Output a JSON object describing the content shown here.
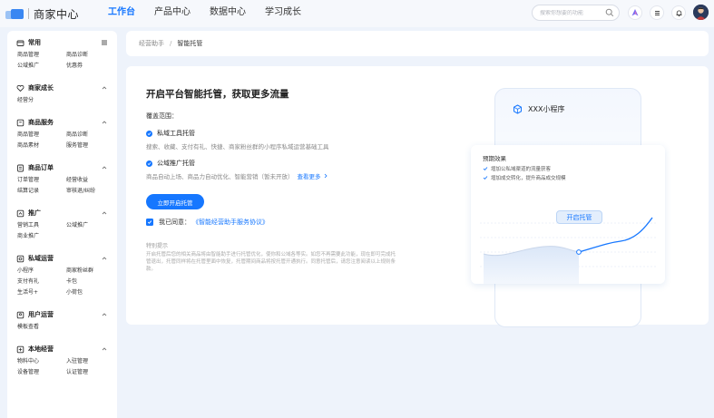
{
  "header": {
    "brand": "商家中心",
    "nav": [
      {
        "label": "工作台",
        "active": true
      },
      {
        "label": "产品中心",
        "active": false
      },
      {
        "label": "数据中心",
        "active": false
      },
      {
        "label": "学习成长",
        "active": false
      }
    ],
    "search_placeholder": "搜索你想要的功能",
    "icons": [
      "search-icon",
      "assistant-icon",
      "menu-icon",
      "bell-icon",
      "avatar"
    ],
    "accent": "#1677ff"
  },
  "sidebar": {
    "sections": [
      {
        "title": "常用",
        "icon": "folder-icon",
        "toggle": "list-icon",
        "items": [
          "商品管理",
          "商品诊断",
          "公域推广",
          "优惠券"
        ]
      },
      {
        "title": "商家成长",
        "icon": "heart-icon",
        "toggle": "chevron-up-icon",
        "items": [
          "经营分"
        ]
      },
      {
        "title": "商品服务",
        "icon": "box-icon",
        "toggle": "chevron-up-icon",
        "items": [
          "商品管理",
          "商品诊断",
          "商品素材",
          "服务管理"
        ]
      },
      {
        "title": "商品订单",
        "icon": "order-icon",
        "toggle": "chevron-up-icon",
        "items": [
          "订单管理",
          "经营收益",
          "结算记录",
          "审核退/纠纷"
        ]
      },
      {
        "title": "推广",
        "icon": "promo-icon",
        "toggle": "chevron-up-icon",
        "items": [
          "营销工具",
          "公域推广",
          "商业推广"
        ]
      },
      {
        "title": "私域运营",
        "icon": "private-icon",
        "toggle": "chevron-up-icon",
        "items": [
          "小程序",
          "商家粉丝群",
          "支付有礼",
          "卡包",
          "生活号+",
          "小荷包"
        ]
      },
      {
        "title": "用户运营",
        "icon": "user-icon",
        "toggle": "chevron-up-icon",
        "items": [
          "模板查看"
        ]
      },
      {
        "title": "本地经营",
        "icon": "local-icon",
        "toggle": "chevron-up-icon",
        "items": [
          "物料中心",
          "入驻管理",
          "设备管理",
          "认证管理"
        ]
      }
    ]
  },
  "breadcrumb": {
    "parent": "经营助手",
    "separator": "/",
    "current": "智能托管"
  },
  "main": {
    "title": "开启平台智能托管，获取更多流量",
    "scope_label": "覆盖范围：",
    "features": [
      {
        "title": "私域工具托管",
        "desc": "搜索、收藏、支付有礼、快捷、商家粉丝群的小程序私域运营基础工具",
        "more": ""
      },
      {
        "title": "公域推广托管",
        "desc": "商品自动上场、商品力自动优化、智能营销（暂未开放）",
        "more": "查看更多"
      }
    ],
    "cta": "立即开启托管",
    "agree_prefix": "我已同意：",
    "agree_link": "《智能经营助手服务协议》",
    "tip_title": "特别提示",
    "tip_desc": "开启托管后您的相关商品将由智能助手进行托管优化，使你和公域各等实。如您不再需要此功能，现在即可完成托管退出，托管同样将在托管里面中恢复，托管期间商品将按托管开通执行。同意托管后，请您注意阅读以上规则条款。",
    "preview": {
      "mini_title": "XXX小程序",
      "effect_title": "预期效果",
      "effects": [
        "增加公私域渠道的流量获客",
        "增加成交转化，提升商品成交规模"
      ],
      "bubble": "开启托管"
    }
  }
}
